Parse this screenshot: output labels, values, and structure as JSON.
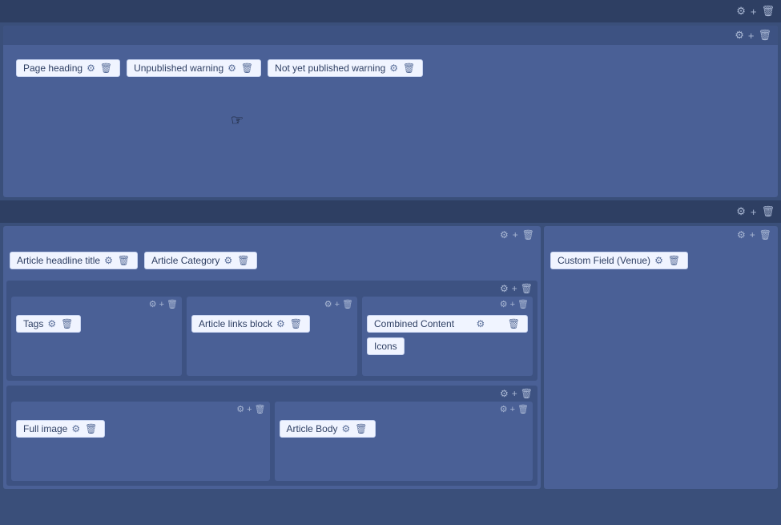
{
  "top_toolbar": {
    "gear_icon": "⚙",
    "plus_icon": "+",
    "delete_icon": "🗑"
  },
  "section1": {
    "toolbar": {
      "gear_icon": "⚙",
      "plus_icon": "+",
      "delete_icon": "🗑"
    },
    "chips": [
      {
        "label": "Page heading",
        "gear_icon": "⚙",
        "delete_icon": "🗑"
      },
      {
        "label": "Unpublished warning",
        "gear_icon": "⚙",
        "delete_icon": "🗑"
      },
      {
        "label": "Not yet published warning",
        "gear_icon": "⚙",
        "delete_icon": "🗑"
      }
    ]
  },
  "section2": {
    "main_toolbar": {
      "gear_icon": "⚙",
      "plus_icon": "+",
      "delete_icon": "🗑"
    },
    "left_panel": {
      "panel_toolbar": {
        "gear_icon": "⚙",
        "plus_icon": "+",
        "delete_icon": "🗑"
      },
      "header_chips": [
        {
          "label": "Article headline title",
          "gear_icon": "⚙",
          "delete_icon": "🗑"
        },
        {
          "label": "Article Category",
          "gear_icon": "⚙",
          "delete_icon": "🗑"
        }
      ],
      "subsection1": {
        "toolbar": {
          "gear_icon": "⚙",
          "plus_icon": "+",
          "delete_icon": "🗑"
        },
        "cols": [
          {
            "toolbar": {
              "gear_icon": "⚙",
              "plus_icon": "+",
              "delete_icon": "🗑"
            },
            "chip": {
              "label": "Tags",
              "gear_icon": "⚙",
              "delete_icon": "🗑"
            }
          },
          {
            "toolbar": {
              "gear_icon": "⚙",
              "plus_icon": "+",
              "delete_icon": "🗑"
            },
            "chip": {
              "label": "Article links block",
              "gear_icon": "⚙",
              "delete_icon": "🗑"
            }
          },
          {
            "toolbar": {
              "gear_icon": "⚙",
              "plus_icon": "+",
              "delete_icon": "🗑"
            },
            "chips": [
              {
                "label": "Combined Content"
              },
              {
                "label": "Icons"
              }
            ],
            "extra_icons": {
              "gear_icon": "⚙",
              "delete_icon": "🗑"
            }
          }
        ]
      },
      "subsection2": {
        "toolbar": {
          "gear_icon": "⚙",
          "plus_icon": "+",
          "delete_icon": "🗑"
        },
        "cols": [
          {
            "toolbar": {
              "gear_icon": "⚙",
              "plus_icon": "+",
              "delete_icon": "🗑"
            },
            "chip": {
              "label": "Full image",
              "gear_icon": "⚙",
              "delete_icon": "🗑"
            }
          },
          {
            "toolbar": {
              "gear_icon": "⚙",
              "plus_icon": "+",
              "delete_icon": "🗑"
            },
            "chip": {
              "label": "Article Body",
              "gear_icon": "⚙",
              "delete_icon": "🗑"
            }
          }
        ]
      }
    },
    "right_panel": {
      "panel_toolbar": {
        "gear_icon": "⚙",
        "plus_icon": "+",
        "delete_icon": "🗑"
      },
      "chip": {
        "label": "Custom Field (Venue)",
        "gear_icon": "⚙",
        "delete_icon": "🗑"
      }
    }
  }
}
